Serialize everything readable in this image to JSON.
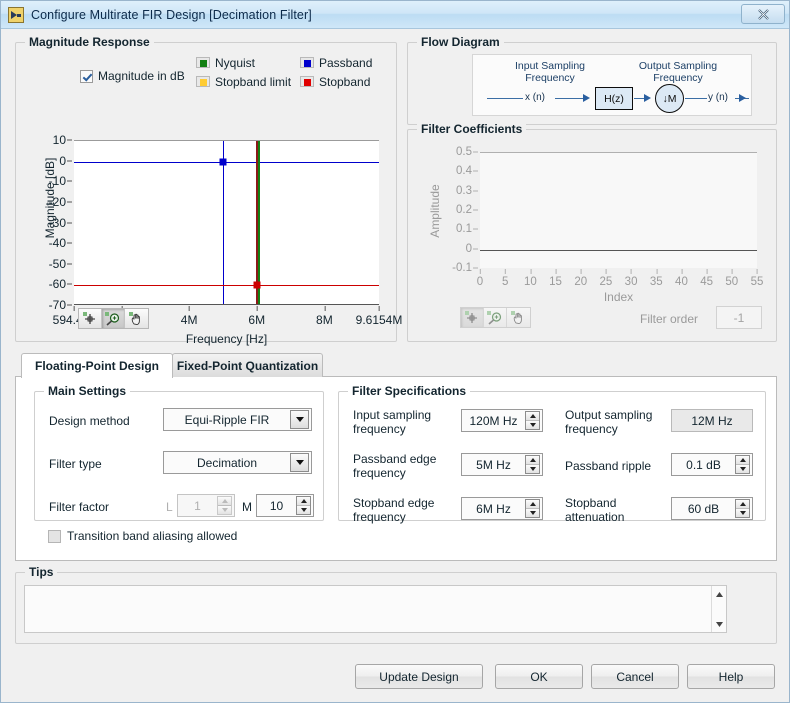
{
  "window": {
    "title": "Configure Multirate FIR Design [Decimation Filter]",
    "close_label": "✕",
    "icon": "labview-vi-icon"
  },
  "magnitude_response": {
    "group_title": "Magnitude Response",
    "magnitude_in_db_label": "Magnitude in dB",
    "magnitude_in_db_checked": true,
    "legend": [
      {
        "label": "Nyquist",
        "color": "#138013"
      },
      {
        "label": "Passband",
        "color": "#0000cc"
      },
      {
        "label": "Stopband limit",
        "color": "#ffcc33"
      },
      {
        "label": "Stopband",
        "color": "#e00000"
      }
    ],
    "toolbar": [
      {
        "name": "cursor-tool",
        "active": false
      },
      {
        "name": "zoom-tool",
        "active": true
      },
      {
        "name": "pan-tool",
        "active": false
      }
    ]
  },
  "flow_diagram": {
    "group_title": "Flow Diagram",
    "input_label_line1": "Input Sampling",
    "input_label_line2": "Frequency",
    "output_label_line1": "Output Sampling",
    "output_label_line2": "Frequency",
    "input_signal": "x (n)",
    "output_signal": "y (n)",
    "filter_block": "H(z)",
    "decimator_block": "↓M"
  },
  "filter_coefficients": {
    "group_title": "Filter Coefficients",
    "filter_order_label": "Filter order",
    "filter_order_value": "-1",
    "toolbar": [
      {
        "name": "cursor-tool",
        "active": true
      },
      {
        "name": "zoom-tool",
        "active": false
      },
      {
        "name": "pan-tool",
        "active": false
      }
    ]
  },
  "tabs": [
    {
      "label": "Floating-Point Design",
      "selected": true
    },
    {
      "label": "Fixed-Point Quantization",
      "selected": false
    }
  ],
  "main_settings": {
    "group_title": "Main Settings",
    "design_method_label": "Design method",
    "design_method_value": "Equi-Ripple FIR",
    "filter_type_label": "Filter type",
    "filter_type_value": "Decimation",
    "filter_factor_label": "Filter factor",
    "l_tag": "L",
    "l_value": "1",
    "l_enabled": false,
    "m_tag": "M",
    "m_value": "10",
    "m_enabled": true,
    "transition_band_label": "Transition band aliasing allowed",
    "transition_band_checked": false
  },
  "filter_specifications": {
    "group_title": "Filter Specifications",
    "fields": [
      {
        "label": "Input sampling\nfrequency",
        "value": "120M Hz",
        "type": "spinner",
        "enabled": true
      },
      {
        "label": "Output sampling\nfrequency",
        "value": "12M Hz",
        "type": "readonly",
        "enabled": false
      },
      {
        "label": "Passband edge\nfrequency",
        "value": "5M Hz",
        "type": "spinner",
        "enabled": true
      },
      {
        "label": "Passband ripple",
        "value": "0.1 dB",
        "type": "spinner",
        "enabled": true
      },
      {
        "label": "Stopband edge\nfrequency",
        "value": "6M Hz",
        "type": "spinner",
        "enabled": true
      },
      {
        "label": "Stopband\nattenuation",
        "value": "60 dB",
        "type": "spinner",
        "enabled": true
      }
    ]
  },
  "tips": {
    "group_title": "Tips",
    "content": ""
  },
  "buttons": [
    {
      "label": "Update Design",
      "name": "update-design-button"
    },
    {
      "label": "OK",
      "name": "ok-button"
    },
    {
      "label": "Cancel",
      "name": "cancel-button"
    },
    {
      "label": "Help",
      "name": "help-button"
    }
  ],
  "chart_data": [
    {
      "id": "magnitude-response",
      "type": "line",
      "title": "Magnitude Response",
      "xlabel": "Frequency [Hz]",
      "ylabel": "Magnitude [dB]",
      "xlim": [
        594410,
        9615400
      ],
      "ylim": [
        -70,
        10
      ],
      "xtick_labels": [
        "594.41k",
        "2M",
        "4M",
        "6M",
        "8M",
        "9.6154M"
      ],
      "xtick_values": [
        594410,
        2000000,
        4000000,
        6000000,
        8000000,
        9615400
      ],
      "ytick_labels": [
        "10",
        "0",
        "-10",
        "-20",
        "-30",
        "-40",
        "-50",
        "-60",
        "-70"
      ],
      "ytick_values": [
        10,
        0,
        -10,
        -20,
        -30,
        -40,
        -50,
        -60,
        -70
      ],
      "grid": false,
      "series": [
        {
          "name": "Passband",
          "kind": "hline",
          "y": 0,
          "color": "#0000cc"
        },
        {
          "name": "Passband edge",
          "kind": "vline",
          "x": 5000000,
          "color": "#0000cc"
        },
        {
          "name": "Passband marker",
          "kind": "point",
          "x": 5000000,
          "y": 0,
          "color": "#0000cc"
        },
        {
          "name": "Stopband",
          "kind": "hline",
          "y": -60,
          "color": "#cc0000"
        },
        {
          "name": "Stopband edge",
          "kind": "vline",
          "x": 6000000,
          "color": "#8b1a1a"
        },
        {
          "name": "Nyquist",
          "kind": "vline",
          "x": 6000000,
          "color": "#138013"
        },
        {
          "name": "Stopband marker",
          "kind": "point",
          "x": 6000000,
          "y": -60,
          "color": "#cc0000"
        }
      ]
    },
    {
      "id": "filter-coefficients",
      "type": "line",
      "title": "Filter Coefficients",
      "xlabel": "Index",
      "ylabel": "Amplitude",
      "xlim": [
        0,
        55
      ],
      "ylim": [
        -0.1,
        0.5
      ],
      "xtick_labels": [
        "0",
        "5",
        "10",
        "15",
        "20",
        "25",
        "30",
        "35",
        "40",
        "45",
        "50",
        "55"
      ],
      "xtick_values": [
        0,
        5,
        10,
        15,
        20,
        25,
        30,
        35,
        40,
        45,
        50,
        55
      ],
      "ytick_labels": [
        "0.5",
        "0.4",
        "0.3",
        "0.2",
        "0.1",
        "0",
        "-0.1"
      ],
      "ytick_values": [
        0.5,
        0.4,
        0.3,
        0.2,
        0.1,
        0,
        -0.1
      ],
      "grid": false,
      "disabled": true,
      "series": [
        {
          "name": "Coefficients",
          "kind": "hline",
          "y": 0,
          "color": "#555555"
        }
      ]
    }
  ]
}
